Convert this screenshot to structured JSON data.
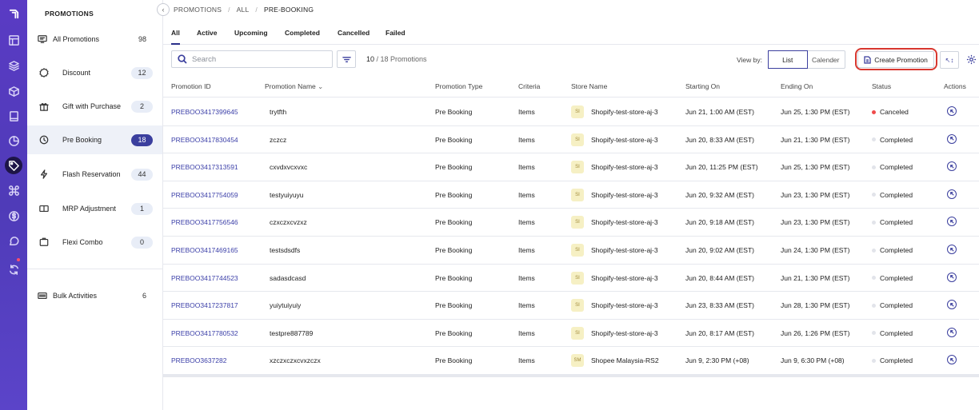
{
  "rail": {
    "icons": [
      "logo-icon",
      "layout-icon",
      "layers-icon",
      "box-icon",
      "book-icon",
      "pie-chart-icon",
      "tag-icon",
      "command-icon",
      "dollar-icon",
      "chat-icon",
      "sync-icon"
    ]
  },
  "sidebar": {
    "title": "PROMOTIONS",
    "all": {
      "label": "All Promotions",
      "count": "98"
    },
    "items": [
      {
        "label": "Discount",
        "count": "12",
        "icon": "discount-icon"
      },
      {
        "label": "Gift with Purchase",
        "count": "2",
        "icon": "gift-icon"
      },
      {
        "label": "Pre Booking",
        "count": "18",
        "icon": "clock-icon"
      },
      {
        "label": "Flash Reservation",
        "count": "44",
        "icon": "flash-icon"
      },
      {
        "label": "MRP Adjustment",
        "count": "1",
        "icon": "mrp-icon"
      },
      {
        "label": "Flexi Combo",
        "count": "0",
        "icon": "combo-icon"
      }
    ],
    "bulk": {
      "label": "Bulk Activities",
      "count": "6"
    }
  },
  "breadcrumb": [
    "PROMOTIONS",
    "ALL",
    "PRE-BOOKING"
  ],
  "tabs": [
    "All",
    "Active",
    "Upcoming",
    "Completed",
    "Cancelled",
    "Failed"
  ],
  "toolbar": {
    "search_placeholder": "Search",
    "count_shown": "10",
    "count_total": "/ 18 Promotions",
    "view_by_label": "View by:",
    "view_list": "List",
    "view_calender": "Calender",
    "create_label": "Create Promotion",
    "expand_label": "↖↕"
  },
  "table": {
    "headers": [
      "Promotion ID",
      "Promotion Name",
      "Promotion Type",
      "Criteria",
      "Store Name",
      "Starting On",
      "Ending On",
      "Status",
      "Actions"
    ],
    "rows": [
      {
        "id": "PREBOO3417399645",
        "name": "trytfth",
        "type": "Pre Booking",
        "criteria": "Items",
        "badge": "SI",
        "store": "Shopify-test-store-aj-3",
        "start": "Jun 21, 1:00 AM (EST)",
        "end": "Jun 25, 1:30 PM (EST)",
        "status": "Canceled"
      },
      {
        "id": "PREBOO3417830454",
        "name": "zczcz",
        "type": "Pre Booking",
        "criteria": "Items",
        "badge": "SI",
        "store": "Shopify-test-store-aj-3",
        "start": "Jun 20, 8:33 AM (EST)",
        "end": "Jun 21, 1:30 PM (EST)",
        "status": "Completed"
      },
      {
        "id": "PREBOO3417313591",
        "name": "cxvdxvcxvxc",
        "type": "Pre Booking",
        "criteria": "Items",
        "badge": "SI",
        "store": "Shopify-test-store-aj-3",
        "start": "Jun 20, 11:25 PM (EST)",
        "end": "Jun 25, 1:30 PM (EST)",
        "status": "Completed"
      },
      {
        "id": "PREBOO3417754059",
        "name": "testyuiyuyu",
        "type": "Pre Booking",
        "criteria": "Items",
        "badge": "SI",
        "store": "Shopify-test-store-aj-3",
        "start": "Jun 20, 9:32 AM (EST)",
        "end": "Jun 23, 1:30 PM (EST)",
        "status": "Completed"
      },
      {
        "id": "PREBOO3417756546",
        "name": "czxczxcvzxz",
        "type": "Pre Booking",
        "criteria": "Items",
        "badge": "SI",
        "store": "Shopify-test-store-aj-3",
        "start": "Jun 20, 9:18 AM (EST)",
        "end": "Jun 23, 1:30 PM (EST)",
        "status": "Completed"
      },
      {
        "id": "PREBOO3417469165",
        "name": "testsdsdfs",
        "type": "Pre Booking",
        "criteria": "Items",
        "badge": "SI",
        "store": "Shopify-test-store-aj-3",
        "start": "Jun 20, 9:02 AM (EST)",
        "end": "Jun 24, 1:30 PM (EST)",
        "status": "Completed"
      },
      {
        "id": "PREBOO3417744523",
        "name": "sadasdcasd",
        "type": "Pre Booking",
        "criteria": "Items",
        "badge": "SI",
        "store": "Shopify-test-store-aj-3",
        "start": "Jun 20, 8:44 AM (EST)",
        "end": "Jun 21, 1:30 PM (EST)",
        "status": "Completed"
      },
      {
        "id": "PREBOO3417237817",
        "name": "yuiytuiyuiy",
        "type": "Pre Booking",
        "criteria": "Items",
        "badge": "SI",
        "store": "Shopify-test-store-aj-3",
        "start": "Jun 23, 8:33 AM (EST)",
        "end": "Jun 28, 1:30 PM (EST)",
        "status": "Completed"
      },
      {
        "id": "PREBOO3417780532",
        "name": "testpre887789",
        "type": "Pre Booking",
        "criteria": "Items",
        "badge": "SI",
        "store": "Shopify-test-store-aj-3",
        "start": "Jun 20, 8:17 AM (EST)",
        "end": "Jun 26, 1:26 PM (EST)",
        "status": "Completed"
      },
      {
        "id": "PREBOO3637282",
        "name": "xzczxczxcvxzczx",
        "type": "Pre Booking",
        "criteria": "Items",
        "badge": "SM",
        "store": "Shopee Malaysia-RS2",
        "start": "Jun 9, 2:30 PM (+08)",
        "end": "Jun 9, 6:30 PM (+08)",
        "status": "Completed"
      }
    ]
  },
  "colors": {
    "rail": "#5a3bc4",
    "accent": "#3b3f9e",
    "highlight": "#d8372f",
    "canceled": "#ef4b4b"
  }
}
